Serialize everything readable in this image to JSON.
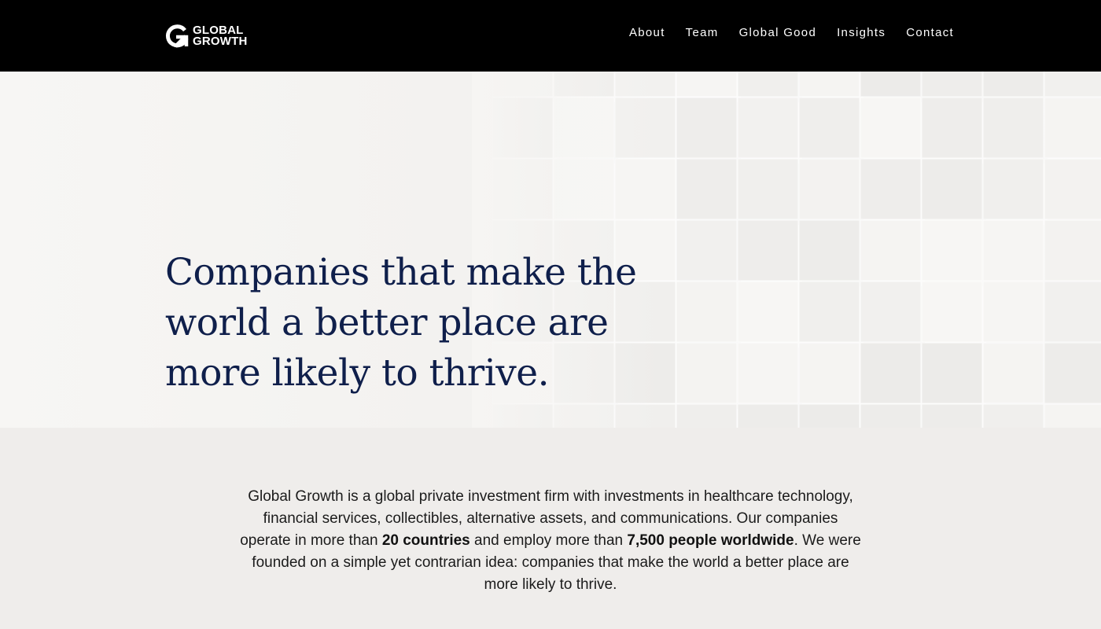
{
  "brand": {
    "logo_line1": "GLOBAL",
    "logo_line2": "GROWTH",
    "icon": "g-arrow-logo-icon"
  },
  "nav": {
    "items": [
      {
        "label": "About"
      },
      {
        "label": "Team"
      },
      {
        "label": "Global Good"
      },
      {
        "label": "Insights"
      },
      {
        "label": "Contact"
      }
    ]
  },
  "hero": {
    "headline": "Companies that make the world a better place are more likely to thrive.",
    "background": "white-3d-cubes-pattern"
  },
  "about": {
    "part1": "Global Growth is a global private investment firm with investments in healthcare technology, financial services, collectibles, alternative assets, and communications. Our companies operate in more than ",
    "countries": "20 countries",
    "part2": " and employ more than ",
    "people": "7,500 people worldwide",
    "part3": ". We were founded on a simple yet contrarian idea: companies that make the world a better place are more likely to thrive."
  },
  "colors": {
    "header_bg": "#000000",
    "headline": "#0f1f4b",
    "page_bg": "#efedeb",
    "body_text": "#1b1b1b"
  }
}
